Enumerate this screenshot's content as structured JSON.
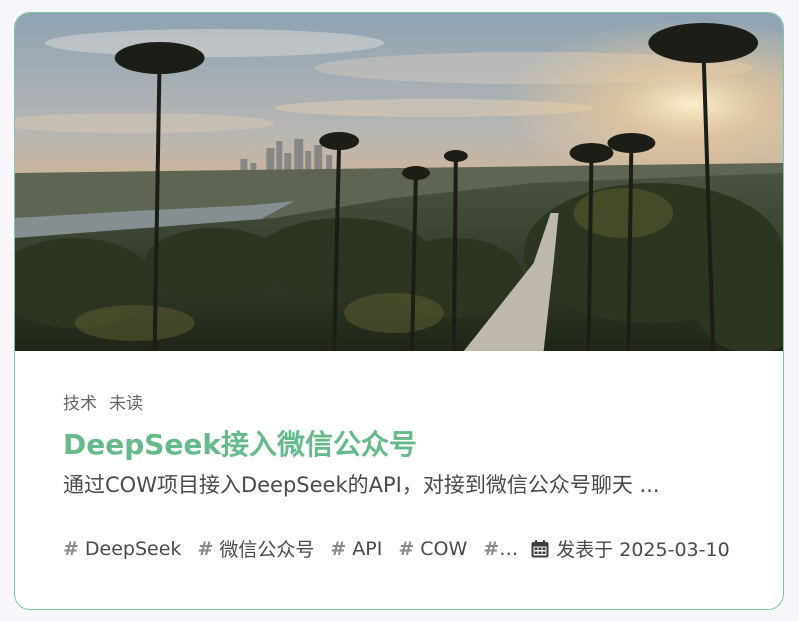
{
  "post": {
    "categories": [
      "技术",
      "未读"
    ],
    "title": "DeepSeek接入微信公众号",
    "summary": "通过COW项目接入DeepSeek的API，对接到微信公众号聊天 ...",
    "tags": [
      "DeepSeek",
      "微信公众号",
      "API",
      "COW"
    ],
    "tag_overflow": "",
    "hash_symbol": "#",
    "date_label": "发表于 2025-03-10",
    "cover_icon": "city-palm-trees-sunset-photo",
    "date_icon": "calendar-icon"
  },
  "colors": {
    "accent": "#66b98b",
    "border": "#7cc6a0",
    "text": "#4a4a4a",
    "muted": "#666666"
  }
}
